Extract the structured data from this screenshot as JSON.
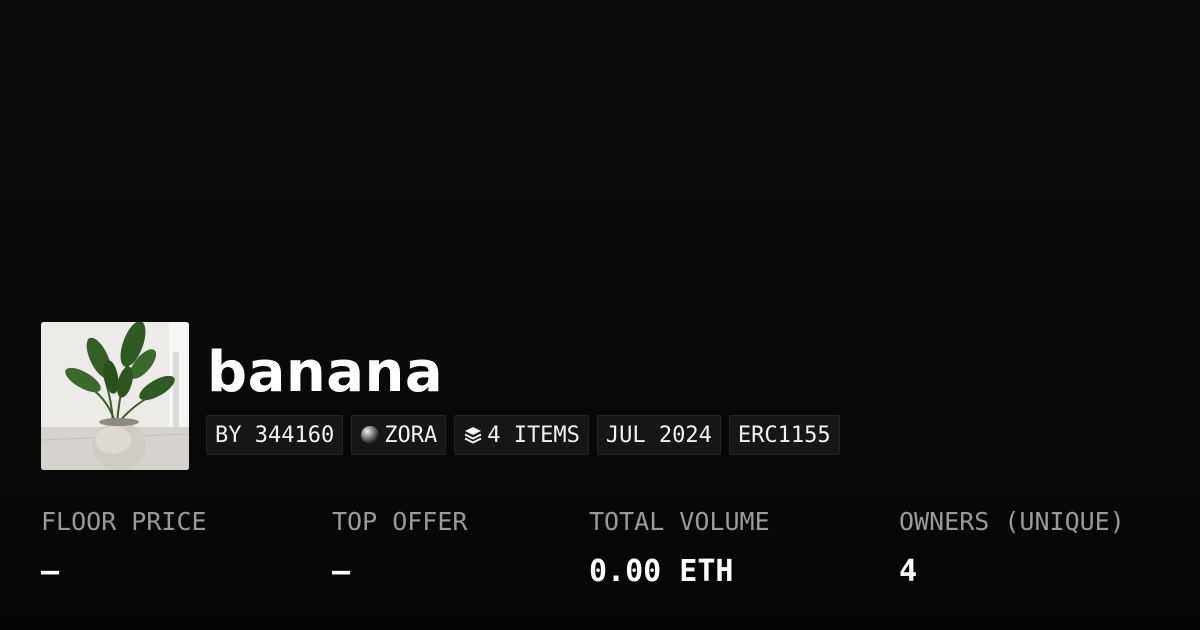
{
  "collection": {
    "name": "banana",
    "thumbnail_icon": "potted-plant-image"
  },
  "tags": {
    "creator": "BY 344160",
    "network": "ZORA",
    "network_icon": "zora-orb-icon",
    "items": "4 ITEMS",
    "items_icon": "layers-icon",
    "date": "JUL 2024",
    "standard": "ERC1155"
  },
  "stats": {
    "floor_price": {
      "label": "FLOOR PRICE",
      "value": "–"
    },
    "top_offer": {
      "label": "TOP OFFER",
      "value": "–"
    },
    "total_volume": {
      "label": "TOTAL VOLUME",
      "value": "0.00 ETH"
    },
    "owners": {
      "label": "OWNERS (UNIQUE)",
      "value": "4"
    }
  },
  "colors": {
    "background": "#0b0b0b",
    "tag_background": "#161616",
    "label_gray": "#9a9a9a",
    "text": "#ffffff"
  }
}
